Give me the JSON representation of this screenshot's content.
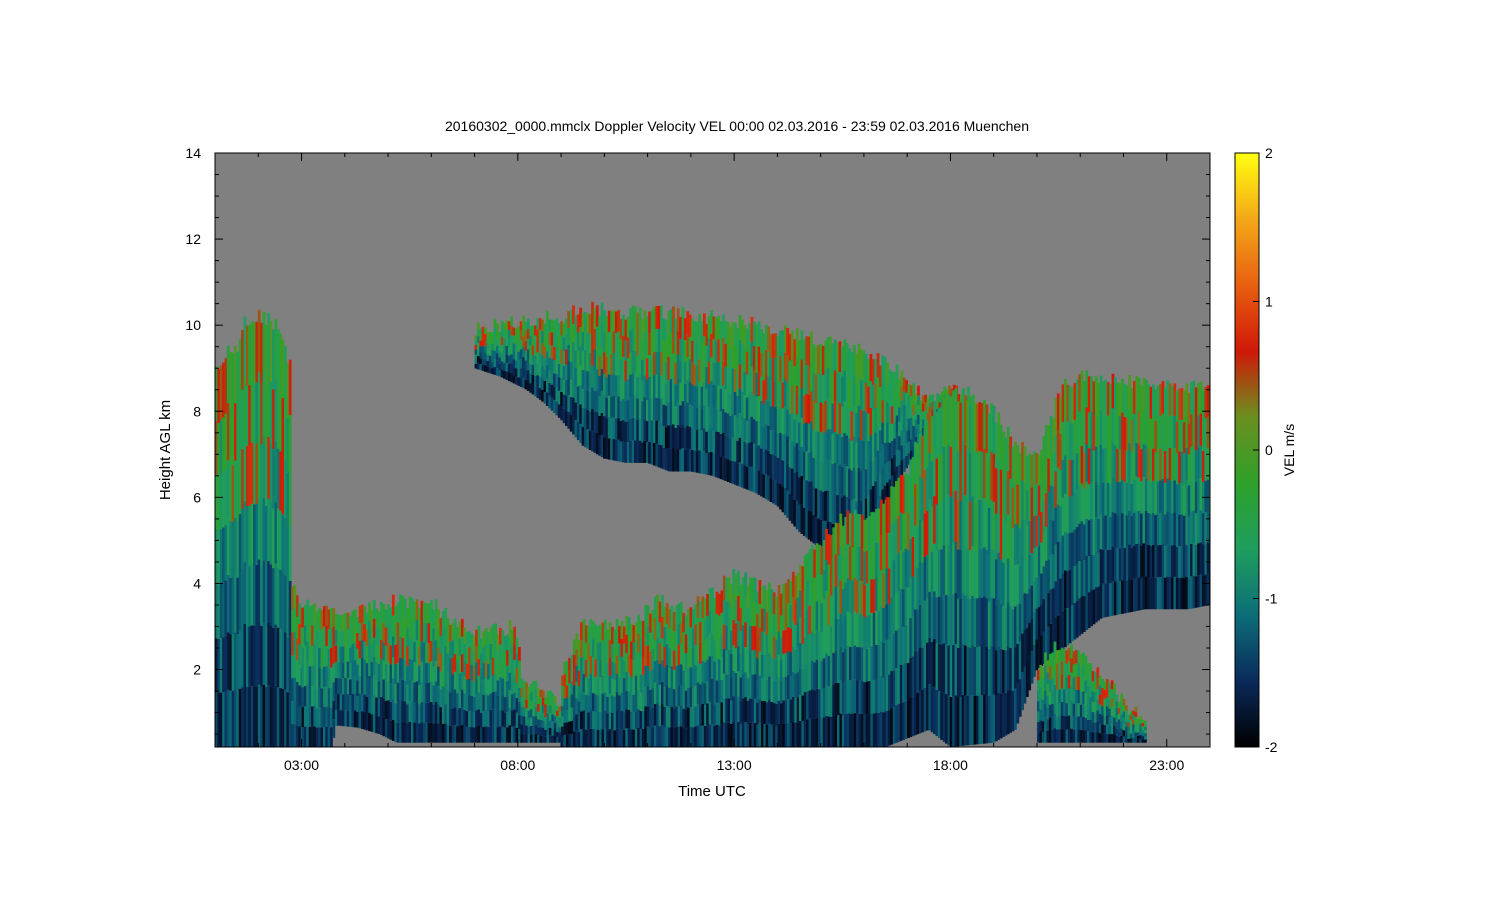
{
  "chart_data": {
    "type": "heatmap",
    "title": "20160302_0000.mmclx Doppler Velocity VEL   00:00 02.03.2016 - 23:59 02.03.2016 Muenchen",
    "xlabel": "Time UTC",
    "ylabel": "Height AGL km",
    "x_range_hours": [
      1.0,
      24.0
    ],
    "x_ticks": [
      {
        "value": 3,
        "label": "03:00"
      },
      {
        "value": 8,
        "label": "08:00"
      },
      {
        "value": 13,
        "label": "13:00"
      },
      {
        "value": 18,
        "label": "18:00"
      },
      {
        "value": 23,
        "label": "23:00"
      }
    ],
    "ylim": [
      0.2,
      14
    ],
    "y_ticks": [
      2,
      4,
      6,
      8,
      10,
      12,
      14
    ],
    "background_color": "#808080",
    "colorbar": {
      "label": "VEL m/s",
      "range": [
        -2,
        2
      ],
      "ticks": [
        2,
        1,
        0,
        -1,
        -2
      ],
      "colors": [
        "#000000",
        "#0a2a5a",
        "#0c6e78",
        "#1f9e5e",
        "#2ea02a",
        "#6b8f1f",
        "#d01808",
        "#e86010",
        "#f4a818",
        "#ffff10"
      ]
    },
    "echo_regions": [
      {
        "name": "early-column",
        "start": 1.0,
        "end": 3.0,
        "top": [
          [
            1.0,
            8.9
          ],
          [
            1.2,
            9.3
          ],
          [
            1.55,
            9.5
          ],
          [
            1.7,
            10.1
          ],
          [
            2.0,
            10.2
          ],
          [
            2.3,
            10.1
          ],
          [
            2.55,
            9.8
          ],
          [
            2.75,
            9.0
          ],
          [
            2.75,
            6.8
          ],
          [
            2.4,
            6.4
          ],
          [
            2.35,
            5.0
          ],
          [
            2.5,
            4.4
          ],
          [
            2.85,
            3.8
          ],
          [
            3.0,
            3.55
          ]
        ],
        "bottom": [
          [
            1.0,
            0.2
          ],
          [
            3.0,
            0.2
          ]
        ]
      },
      {
        "name": "low-cloud-morning",
        "start": 3.0,
        "end": 9.0,
        "top": [
          [
            3.0,
            3.55
          ],
          [
            3.6,
            3.4
          ],
          [
            4.0,
            3.3
          ],
          [
            4.5,
            3.45
          ],
          [
            5.3,
            3.6
          ],
          [
            6.0,
            3.55
          ],
          [
            6.4,
            3.2
          ],
          [
            6.9,
            2.9
          ],
          [
            7.5,
            2.9
          ],
          [
            7.9,
            3.0
          ],
          [
            8.05,
            2.6
          ],
          [
            8.05,
            1.8
          ],
          [
            8.4,
            1.6
          ],
          [
            8.6,
            1.5
          ],
          [
            9.0,
            1.2
          ]
        ],
        "bottom": [
          [
            3.0,
            0.2
          ],
          [
            3.7,
            0.2
          ],
          [
            3.8,
            0.7
          ],
          [
            4.3,
            0.65
          ],
          [
            4.8,
            0.5
          ],
          [
            5.2,
            0.3
          ],
          [
            9.0,
            0.3
          ]
        ]
      },
      {
        "name": "upper-cloud-midday",
        "start": 7.0,
        "end": 18.5,
        "top": [
          [
            7.0,
            9.9
          ],
          [
            7.5,
            10.0
          ],
          [
            8.0,
            10.1
          ],
          [
            9.0,
            10.2
          ],
          [
            9.6,
            10.4
          ],
          [
            10.5,
            10.3
          ],
          [
            11.5,
            10.3
          ],
          [
            12.3,
            10.2
          ],
          [
            13.0,
            10.1
          ],
          [
            14.0,
            9.9
          ],
          [
            14.5,
            9.8
          ],
          [
            15.0,
            9.6
          ],
          [
            15.8,
            9.5
          ],
          [
            16.3,
            9.3
          ],
          [
            16.8,
            8.9
          ],
          [
            17.4,
            8.3
          ],
          [
            18.0,
            8.5
          ],
          [
            18.5,
            8.4
          ]
        ],
        "bottom": [
          [
            7.0,
            9.0
          ],
          [
            7.6,
            8.8
          ],
          [
            8.2,
            8.5
          ],
          [
            8.6,
            8.2
          ],
          [
            9.0,
            7.8
          ],
          [
            9.5,
            7.2
          ],
          [
            10.0,
            6.9
          ],
          [
            10.5,
            6.8
          ],
          [
            11.0,
            6.8
          ],
          [
            11.5,
            6.6
          ],
          [
            12.0,
            6.6
          ],
          [
            12.5,
            6.5
          ],
          [
            13.0,
            6.3
          ],
          [
            13.5,
            6.1
          ],
          [
            14.0,
            5.8
          ],
          [
            14.5,
            5.2
          ],
          [
            15.0,
            4.8
          ],
          [
            15.5,
            4.6
          ],
          [
            16.0,
            4.5
          ],
          [
            16.4,
            5.6
          ],
          [
            16.8,
            6.4
          ],
          [
            17.2,
            7.0
          ],
          [
            17.8,
            7.2
          ],
          [
            18.5,
            7.2
          ]
        ]
      },
      {
        "name": "low-cloud-afternoon",
        "start": 9.0,
        "end": 16.5,
        "top": [
          [
            9.0,
            1.8
          ],
          [
            9.2,
            2.4
          ],
          [
            9.5,
            3.0
          ],
          [
            10.0,
            3.0
          ],
          [
            10.8,
            3.2
          ],
          [
            11.2,
            3.6
          ],
          [
            12.0,
            3.4
          ],
          [
            12.5,
            3.8
          ],
          [
            13.0,
            4.2
          ],
          [
            13.5,
            4.0
          ],
          [
            14.0,
            3.8
          ],
          [
            14.5,
            4.4
          ],
          [
            15.0,
            5.0
          ],
          [
            15.5,
            5.5
          ],
          [
            16.0,
            5.6
          ],
          [
            16.5,
            6.0
          ]
        ],
        "bottom": [
          [
            9.0,
            0.2
          ],
          [
            16.5,
            0.2
          ]
        ]
      },
      {
        "name": "deep-cloud-evening",
        "start": 16.5,
        "end": 24.0,
        "top": [
          [
            16.5,
            6.0
          ],
          [
            17.0,
            6.6
          ],
          [
            17.5,
            8.0
          ],
          [
            18.0,
            8.4
          ],
          [
            18.5,
            8.3
          ],
          [
            19.0,
            8.0
          ],
          [
            19.5,
            7.2
          ],
          [
            20.0,
            7.0
          ],
          [
            20.3,
            7.8
          ],
          [
            20.6,
            8.6
          ],
          [
            21.0,
            8.8
          ],
          [
            21.5,
            8.8
          ],
          [
            22.0,
            8.7
          ],
          [
            22.5,
            8.7
          ],
          [
            23.0,
            8.6
          ],
          [
            23.5,
            8.6
          ],
          [
            24.0,
            8.5
          ]
        ],
        "bottom": [
          [
            16.5,
            0.2
          ],
          [
            17.0,
            0.4
          ],
          [
            17.5,
            0.6
          ],
          [
            18.0,
            0.2
          ],
          [
            19.0,
            0.3
          ],
          [
            19.5,
            0.6
          ],
          [
            20.0,
            2.0
          ],
          [
            20.5,
            2.4
          ],
          [
            21.0,
            2.8
          ],
          [
            21.5,
            3.2
          ],
          [
            22.0,
            3.3
          ],
          [
            22.5,
            3.4
          ],
          [
            23.0,
            3.4
          ],
          [
            23.5,
            3.4
          ],
          [
            24.0,
            3.5
          ]
        ]
      },
      {
        "name": "late-low-cloud",
        "start": 20.0,
        "end": 22.5,
        "top": [
          [
            20.0,
            2.0
          ],
          [
            20.4,
            2.5
          ],
          [
            20.8,
            2.6
          ],
          [
            21.2,
            2.2
          ],
          [
            21.6,
            1.8
          ],
          [
            22.0,
            1.2
          ],
          [
            22.5,
            0.8
          ]
        ],
        "bottom": [
          [
            20.0,
            0.3
          ],
          [
            22.5,
            0.3
          ]
        ]
      }
    ]
  }
}
